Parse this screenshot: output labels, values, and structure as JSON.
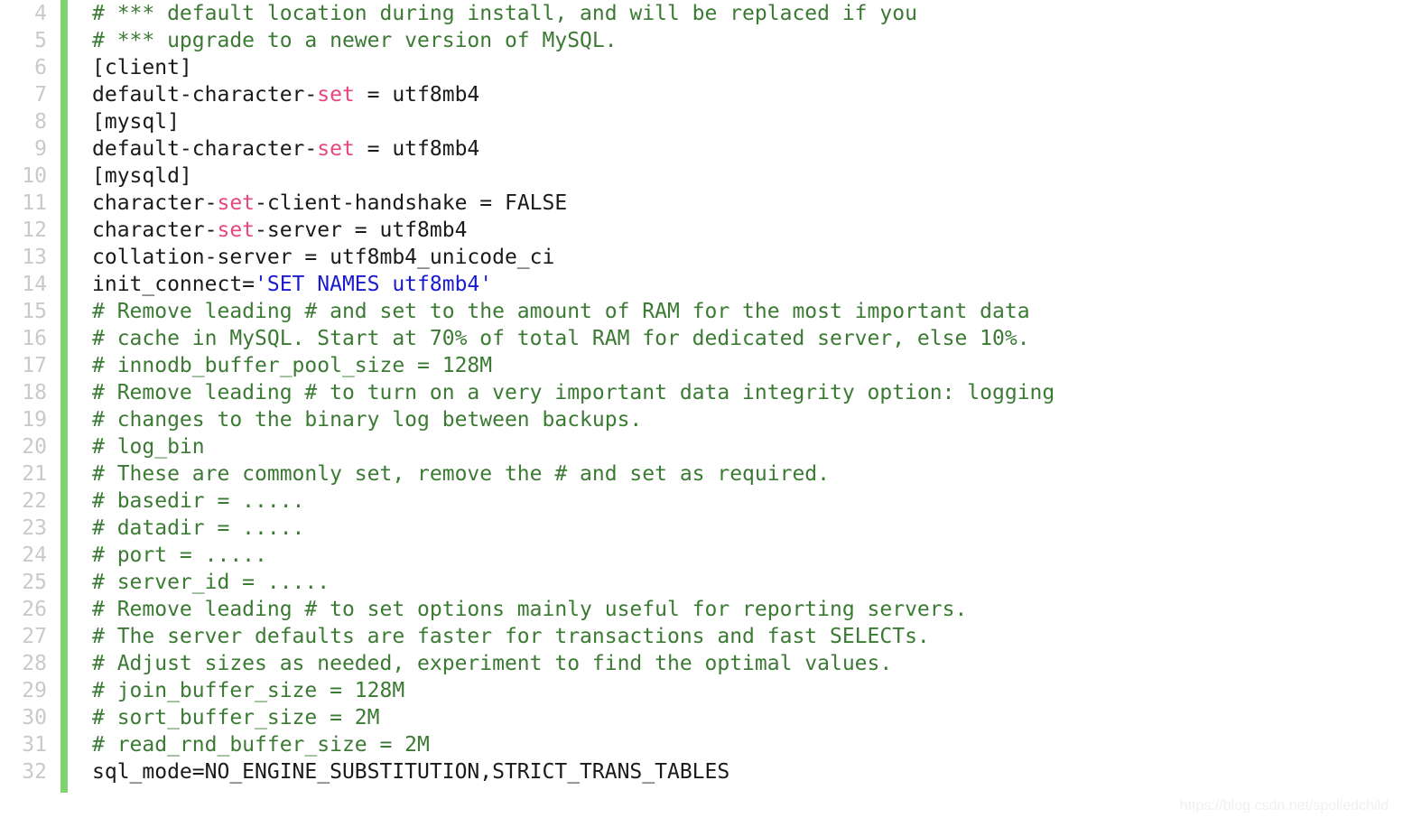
{
  "editor": {
    "title": "my.cnf MySQL configuration file",
    "language": "ini",
    "first_visible_line": 4,
    "last_visible_line": 32,
    "colors": {
      "background": "#ffffff",
      "gutter_bar": "#80d470",
      "line_number": "#c9c9c9",
      "comment": "#3b7a33",
      "keyword": "#e8467d",
      "string": "#1a1ad0",
      "plain": "#1a1a1a",
      "watermark": "#f0f0f0"
    }
  },
  "watermark": {
    "text": "https://blog.csdn.net/spoliedchild"
  },
  "lines": [
    {
      "number": "4",
      "tokens": [
        {
          "type": "comment",
          "text": "# *** default location during install, and will be replaced if you"
        }
      ]
    },
    {
      "number": "5",
      "tokens": [
        {
          "type": "comment",
          "text": "# *** upgrade to a newer version of MySQL."
        }
      ]
    },
    {
      "number": "6",
      "tokens": [
        {
          "type": "plain",
          "text": "[client]"
        }
      ]
    },
    {
      "number": "7",
      "tokens": [
        {
          "type": "plain",
          "text": "default-character-"
        },
        {
          "type": "keyword",
          "text": "set"
        },
        {
          "type": "plain",
          "text": " = utf8mb4"
        }
      ]
    },
    {
      "number": "8",
      "tokens": [
        {
          "type": "plain",
          "text": "[mysql]"
        }
      ]
    },
    {
      "number": "9",
      "tokens": [
        {
          "type": "plain",
          "text": "default-character-"
        },
        {
          "type": "keyword",
          "text": "set"
        },
        {
          "type": "plain",
          "text": " = utf8mb4"
        }
      ]
    },
    {
      "number": "10",
      "tokens": [
        {
          "type": "plain",
          "text": "[mysqld]"
        }
      ]
    },
    {
      "number": "11",
      "tokens": [
        {
          "type": "plain",
          "text": "character-"
        },
        {
          "type": "keyword",
          "text": "set"
        },
        {
          "type": "plain",
          "text": "-client-handshake = FALSE"
        }
      ]
    },
    {
      "number": "12",
      "tokens": [
        {
          "type": "plain",
          "text": "character-"
        },
        {
          "type": "keyword",
          "text": "set"
        },
        {
          "type": "plain",
          "text": "-server = utf8mb4"
        }
      ]
    },
    {
      "number": "13",
      "tokens": [
        {
          "type": "plain",
          "text": "collation-server = utf8mb4_unicode_ci"
        }
      ]
    },
    {
      "number": "14",
      "tokens": [
        {
          "type": "plain",
          "text": "init_connect="
        },
        {
          "type": "string",
          "text": "'SET NAMES utf8mb4'"
        }
      ]
    },
    {
      "number": "15",
      "tokens": [
        {
          "type": "comment",
          "text": "# Remove leading # and set to the amount of RAM for the most important data"
        }
      ]
    },
    {
      "number": "16",
      "tokens": [
        {
          "type": "comment",
          "text": "# cache in MySQL. Start at 70% of total RAM for dedicated server, else 10%."
        }
      ]
    },
    {
      "number": "17",
      "tokens": [
        {
          "type": "comment",
          "text": "# innodb_buffer_pool_size = 128M"
        }
      ]
    },
    {
      "number": "18",
      "tokens": [
        {
          "type": "comment",
          "text": "# Remove leading # to turn on a very important data integrity option: logging"
        }
      ]
    },
    {
      "number": "19",
      "tokens": [
        {
          "type": "comment",
          "text": "# changes to the binary log between backups."
        }
      ]
    },
    {
      "number": "20",
      "tokens": [
        {
          "type": "comment",
          "text": "# log_bin"
        }
      ]
    },
    {
      "number": "21",
      "tokens": [
        {
          "type": "comment",
          "text": "# These are commonly set, remove the # and set as required."
        }
      ]
    },
    {
      "number": "22",
      "tokens": [
        {
          "type": "comment",
          "text": "# basedir = ....."
        }
      ]
    },
    {
      "number": "23",
      "tokens": [
        {
          "type": "comment",
          "text": "# datadir = ....."
        }
      ]
    },
    {
      "number": "24",
      "tokens": [
        {
          "type": "comment",
          "text": "# port = ....."
        }
      ]
    },
    {
      "number": "25",
      "tokens": [
        {
          "type": "comment",
          "text": "# server_id = ....."
        }
      ]
    },
    {
      "number": "26",
      "tokens": [
        {
          "type": "comment",
          "text": "# Remove leading # to set options mainly useful for reporting servers."
        }
      ]
    },
    {
      "number": "27",
      "tokens": [
        {
          "type": "comment",
          "text": "# The server defaults are faster for transactions and fast SELECTs."
        }
      ]
    },
    {
      "number": "28",
      "tokens": [
        {
          "type": "comment",
          "text": "# Adjust sizes as needed, experiment to find the optimal values."
        }
      ]
    },
    {
      "number": "29",
      "tokens": [
        {
          "type": "comment",
          "text": "# join_buffer_size = 128M"
        }
      ]
    },
    {
      "number": "30",
      "tokens": [
        {
          "type": "comment",
          "text": "# sort_buffer_size = 2M"
        }
      ]
    },
    {
      "number": "31",
      "tokens": [
        {
          "type": "comment",
          "text": "# read_rnd_buffer_size = 2M"
        }
      ]
    },
    {
      "number": "32",
      "tokens": [
        {
          "type": "plain",
          "text": "sql_mode=NO_ENGINE_SUBSTITUTION,STRICT_TRANS_TABLES"
        }
      ]
    }
  ]
}
